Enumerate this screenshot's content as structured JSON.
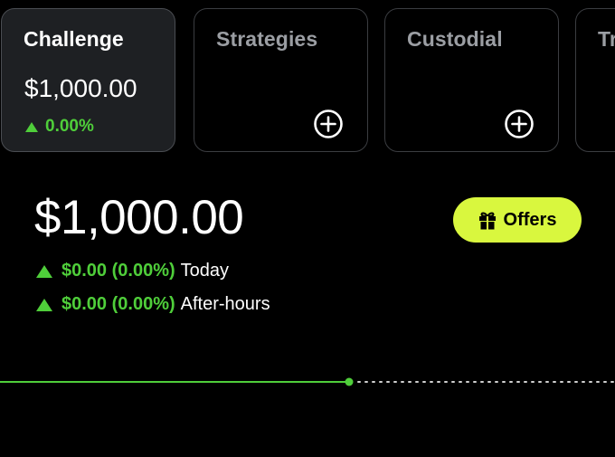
{
  "accounts": [
    {
      "title": "Challenge",
      "value": "$1,000.00",
      "change": "0.00%",
      "selected": true
    },
    {
      "title": "Strategies",
      "add_icon": "add-circle-icon"
    },
    {
      "title": "Custodial",
      "add_icon": "add-circle-icon"
    },
    {
      "title": "Tr"
    }
  ],
  "portfolio": {
    "value": "$1,000.00",
    "today": {
      "amount": "$0.00 (0.00%)",
      "label": "Today"
    },
    "after_hours": {
      "amount": "$0.00 (0.00%)",
      "label": "After-hours"
    }
  },
  "offers": {
    "label": "Offers",
    "icon": "gift-icon"
  },
  "chart": {
    "progress": 0.567
  },
  "colors": {
    "positive": "#4fce3a",
    "accent": "#d9f73e",
    "background": "#000000",
    "card_selected": "#1e2023"
  }
}
